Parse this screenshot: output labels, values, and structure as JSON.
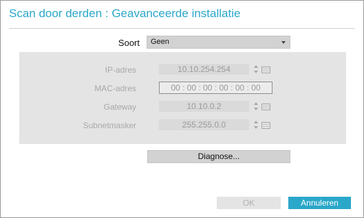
{
  "dialog": {
    "title": "Scan door derden : Geavanceerde installatie"
  },
  "soort": {
    "label": "Soort",
    "value": "Geen",
    "icon": "chevron-down-icon"
  },
  "network": {
    "ip": {
      "label": "IP-adres",
      "value": "10.10.254.254"
    },
    "mac": {
      "label": "MAC-adres",
      "value": "00 : 00 : 00 : 00 : 00 : 00"
    },
    "gateway": {
      "label": "Gateway",
      "value": "10.10.0.2"
    },
    "subnet": {
      "label": "Subnetmasker",
      "value": "255.255.0.0"
    }
  },
  "actions": {
    "diagnose": "Diagnose...",
    "ok": "OK",
    "cancel": "Annuleren"
  },
  "colors": {
    "accent": "#2aa7c9",
    "disabled_text": "#a8a8a8",
    "panel_bg": "#e4e4e4"
  }
}
